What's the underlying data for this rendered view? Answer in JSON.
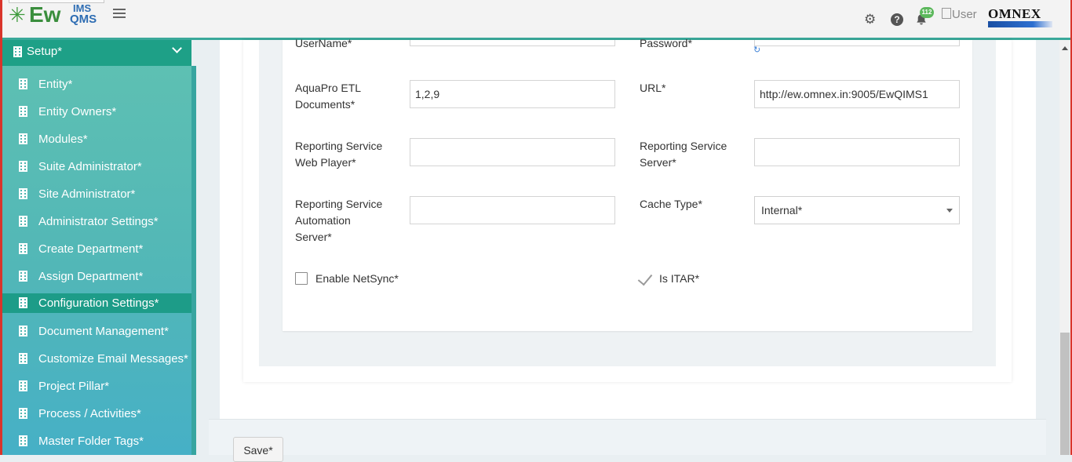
{
  "header": {
    "logo": {
      "ew": "Ew",
      "ims": "IMS",
      "qms": "QMS"
    },
    "notifications_count": "112",
    "user_alt": "User",
    "brand": "OMNEX"
  },
  "sidebar": {
    "section": "Setup*",
    "items": [
      {
        "label": "Entity*"
      },
      {
        "label": "Entity Owners*"
      },
      {
        "label": "Modules*"
      },
      {
        "label": "Suite Administrator*"
      },
      {
        "label": "Site Administrator*"
      },
      {
        "label": "Administrator Settings*"
      },
      {
        "label": "Create Department*"
      },
      {
        "label": "Assign Department*"
      },
      {
        "label": "Configuration Settings*",
        "active": true
      },
      {
        "label": "Document Management*"
      },
      {
        "label": "Customize Email Messages*"
      },
      {
        "label": "Project Pillar*"
      },
      {
        "label": "Process / Activities*"
      },
      {
        "label": "Master Folder Tags*"
      }
    ]
  },
  "form": {
    "username_label": "UserName*",
    "password_label": "Password*",
    "aquapro_label_1": "AquaPro ETL",
    "aquapro_label_2": "Documents*",
    "aquapro_value": "1,2,9",
    "url_label": "URL*",
    "url_value": "http://ew.omnex.in:9005/EwQIMS1",
    "rs_web_label_1": "Reporting Service",
    "rs_web_label_2": "Web Player*",
    "rs_web_value": "",
    "rs_server_label_1": "Reporting Service",
    "rs_server_label_2": "Server*",
    "rs_server_value": "",
    "rs_auto_label_1": "Reporting Service",
    "rs_auto_label_2": "Automation",
    "rs_auto_label_3": "Server*",
    "rs_auto_value": "",
    "cache_label": "Cache Type*",
    "cache_value": "Internal*",
    "netsync_label": "Enable NetSync*",
    "itar_label": "Is ITAR*"
  },
  "footer": {
    "save_label": "Save*"
  },
  "colors": {
    "frame": "#d9342b",
    "header_accent": "#3aa89a",
    "sidebar_active": "#1d9c88",
    "badge": "#5cb85c"
  }
}
